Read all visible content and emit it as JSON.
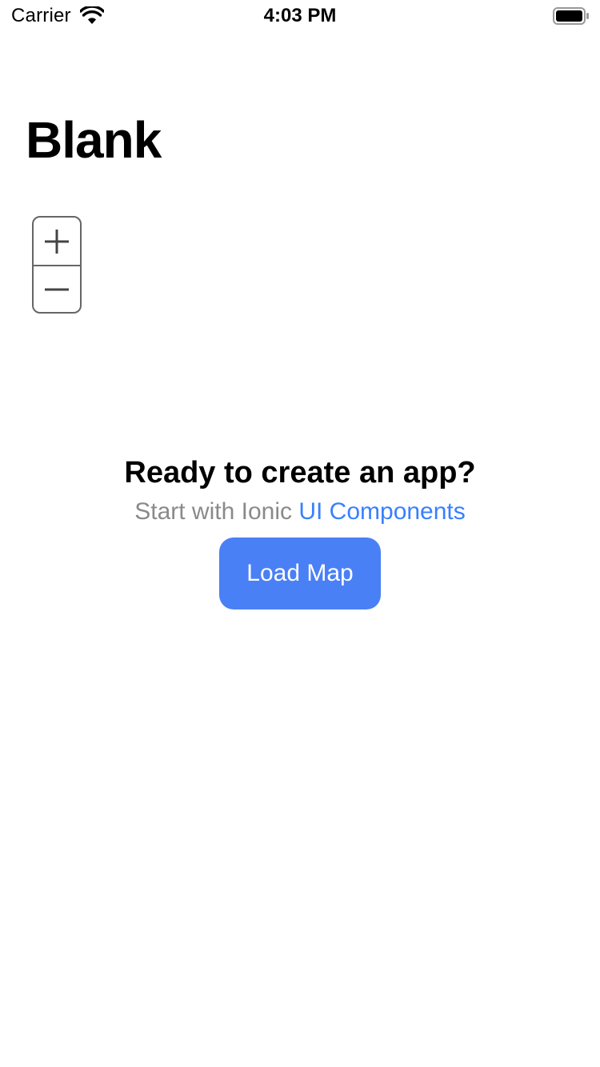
{
  "status_bar": {
    "carrier": "Carrier",
    "time": "4:03 PM",
    "wifi_icon": "wifi-icon",
    "battery_icon": "battery-full-icon"
  },
  "header": {
    "title": "Blank"
  },
  "map_controls": {
    "zoom_in_icon": "plus-icon",
    "zoom_out_icon": "minus-icon"
  },
  "content": {
    "headline": "Ready to create an app?",
    "subline_prefix": "Start with Ionic",
    "subline_link": "UI Components",
    "load_button_label": "Load Map"
  },
  "colors": {
    "accent": "#3880ff",
    "button": "#4a80f5",
    "muted_text": "#8a8a8a"
  }
}
